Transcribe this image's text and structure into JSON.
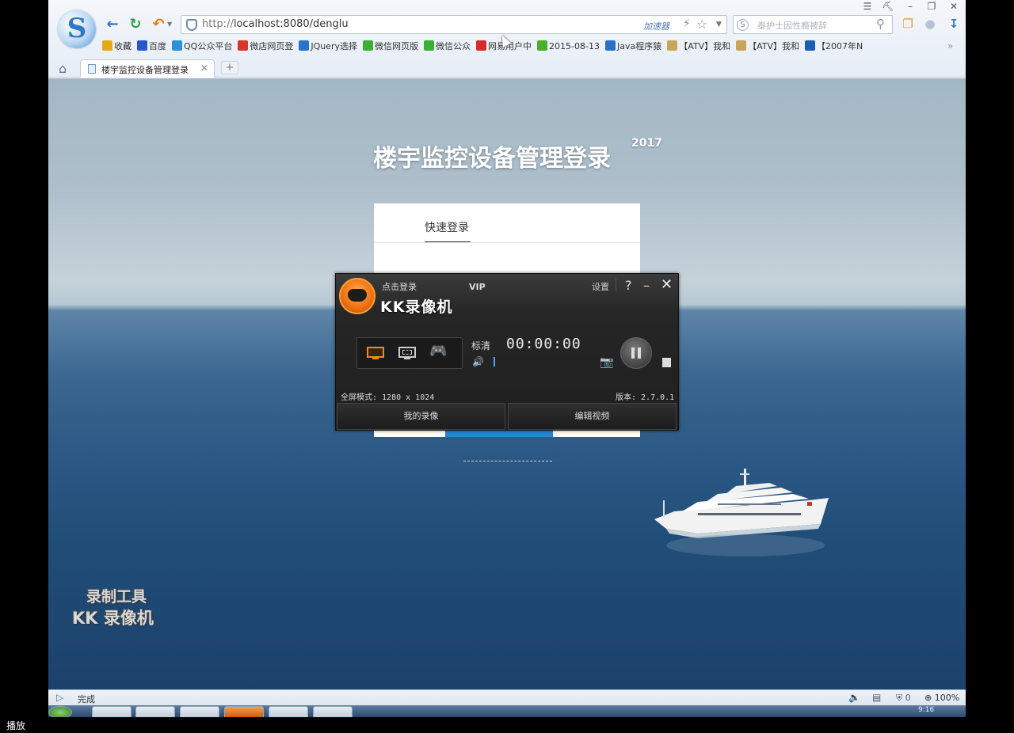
{
  "browser": {
    "logo_letter": "S",
    "url_protocol": "http://",
    "url_rest": "localhost:8080/denglu",
    "accelerator_label": "加速器",
    "search_placeholder": "泰护士因性瘾被辞",
    "window_controls": {
      "menu": "☰",
      "skin": "👕",
      "min": "–",
      "max": "❐",
      "close": "✕"
    },
    "bookmarks": [
      {
        "label": "收藏",
        "icon": "star-icon",
        "color": "#e6a817"
      },
      {
        "label": "百度",
        "icon": "baidu-icon",
        "color": "#2a56c9"
      },
      {
        "label": "QQ公众平台",
        "icon": "qq-icon",
        "color": "#2f8fd8"
      },
      {
        "label": "微店网页登",
        "icon": "store-icon",
        "color": "#d9352b"
      },
      {
        "label": "JQuery选择",
        "icon": "jquery-icon",
        "color": "#2b72c9"
      },
      {
        "label": "微信网页版",
        "icon": "wechat-icon",
        "color": "#3cb034"
      },
      {
        "label": "微信公众",
        "icon": "wechat-icon",
        "color": "#3cb034"
      },
      {
        "label": "网易用户中",
        "icon": "netease-icon",
        "color": "#d62b2b"
      },
      {
        "label": "2015-08-13",
        "icon": "play-icon",
        "color": "#4caf2a"
      },
      {
        "label": "Java程序猿",
        "icon": "java-icon",
        "color": "#2a6fc4"
      },
      {
        "label": "【ATV】我和",
        "icon": "atv-icon",
        "color": "#c9a55a"
      },
      {
        "label": "【ATV】我和",
        "icon": "atv-icon",
        "color": "#c9a55a"
      },
      {
        "label": "【2007年N",
        "icon": "bo-icon",
        "color": "#1a5fb4"
      }
    ],
    "tab_title": "楼宇监控设备管理登录",
    "new_tab": "+",
    "status_text": "完成",
    "status_shield_count": "0",
    "zoom": "100%"
  },
  "page": {
    "title": "楼宇监控设备管理登录",
    "title_sup": "2017",
    "login_tab": "快速登录"
  },
  "kk_recorder": {
    "login_link": "点击登录",
    "vip": "VIP",
    "settings": "设置",
    "help": "?",
    "minimize": "–",
    "close": "✕",
    "title": "KK录像机",
    "quality": "标清",
    "timer": "00:00:00",
    "mode_text": "全屏模式: 1280 x 1024",
    "version": "版本: 2.7.0.1",
    "my_recordings": "我的录像",
    "edit_video": "编辑视频"
  },
  "watermark": {
    "line1": "录制工具",
    "line2": "KK 录像机"
  },
  "taskbar": {
    "clock": "9:16"
  },
  "player_label": "播放"
}
